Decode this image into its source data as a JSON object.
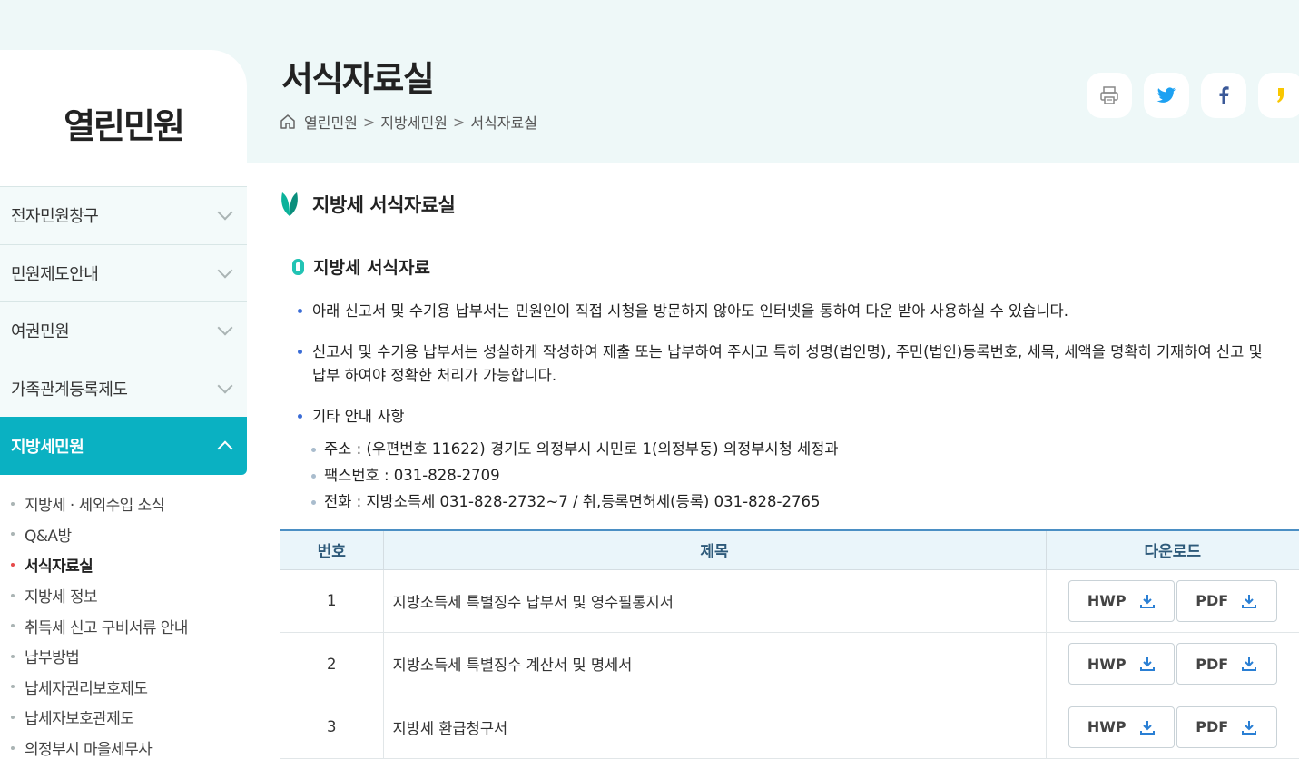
{
  "sidebar": {
    "title": "열린민원",
    "menu": [
      {
        "label": "전자민원창구"
      },
      {
        "label": "민원제도안내"
      },
      {
        "label": "여권민원"
      },
      {
        "label": "가족관계등록제도"
      },
      {
        "label": "지방세민원"
      }
    ],
    "submenu": [
      {
        "label": "지방세 · 세외수입 소식"
      },
      {
        "label": "Q&A방"
      },
      {
        "label": "서식자료실"
      },
      {
        "label": "지방세 정보"
      },
      {
        "label": "취득세 신고 구비서류 안내"
      },
      {
        "label": "납부방법"
      },
      {
        "label": "납세자권리보호제도"
      },
      {
        "label": "납세자보호관제도"
      },
      {
        "label": "의정부시 마을세무사"
      }
    ]
  },
  "header": {
    "title": "서식자료실",
    "breadcrumb": [
      "열린민원",
      "지방세민원",
      "서식자료실"
    ],
    "share": [
      "print-icon",
      "twitter-icon",
      "facebook-icon",
      "kakaostory-icon"
    ]
  },
  "content": {
    "section_title": "지방세 서식자료실",
    "sub_title": "지방세 서식자료",
    "bullets": [
      "아래 신고서 및 수기용 납부서는 민원인이 직접 시청을 방문하지 않아도 인터넷을 통하여 다운 받아 사용하실 수 있습니다.",
      "신고서 및 수기용 납부서는 성실하게 작성하여 제출 또는 납부하여 주시고 특히 성명(법인명), 주민(법인)등록번호, 세목, 세액을 명확히 기재하여 신고 및 납부 하여야 정확한 처리가 가능합니다.",
      "기타 안내 사항"
    ],
    "sub_bullets": [
      "주소 : (우편번호 11622) 경기도 의정부시 시민로 1(의정부동) 의정부시청 세정과",
      "팩스번호 : 031-828-2709",
      "전화 : 지방소득세 031-828-2732~7 / 취,등록면허세(등록) 031-828-2765"
    ]
  },
  "table": {
    "headers": [
      "번호",
      "제목",
      "다운로드"
    ],
    "hwp_label": "HWP",
    "pdf_label": "PDF",
    "rows": [
      {
        "no": "1",
        "title": "지방소득세 특별징수 납부서 및 영수필통지서"
      },
      {
        "no": "2",
        "title": "지방소득세 특별징수 계산서 및 명세서"
      },
      {
        "no": "3",
        "title": "지방세 환급청구서"
      }
    ]
  },
  "colors": {
    "accent": "#0ab1c2",
    "header_bg": "#eef8f8",
    "table_head": "#eaf5fa"
  }
}
